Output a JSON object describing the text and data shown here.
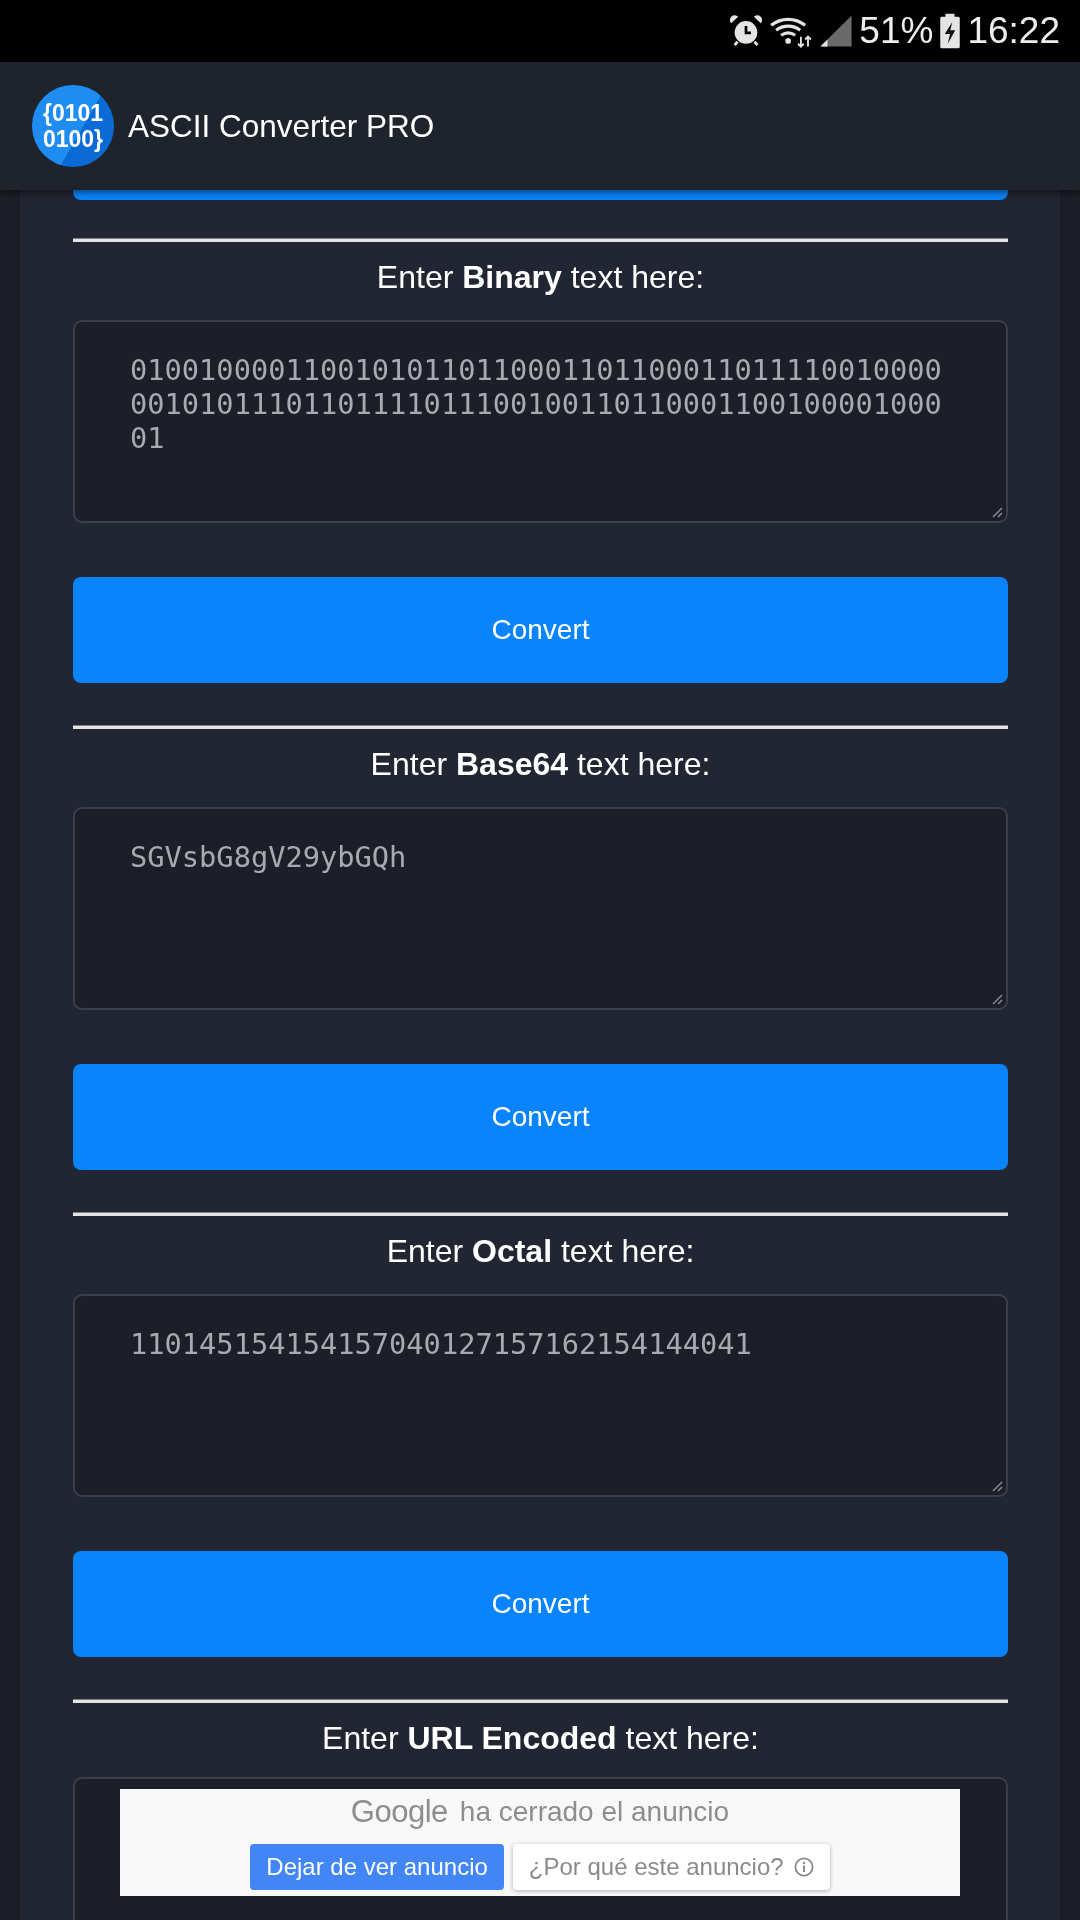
{
  "status_bar": {
    "battery": "51%",
    "time": "16:22"
  },
  "app_bar": {
    "logo": [
      "{0101",
      "0100}"
    ],
    "title": "ASCII Converter PRO"
  },
  "sections": [
    {
      "label": "Enter **Binary** text here:",
      "value": "010010000110010101101100011011000110111100100000010101110110111101110010011011000110010000100001",
      "button": "Convert"
    },
    {
      "label": "Enter **Base64** text here:",
      "value": "SGVsbG8gV29ybGQh",
      "button": "Convert"
    },
    {
      "label": "Enter **Octal** text here:",
      "value": "110145154154157040127157162154144041",
      "button": "Convert"
    },
    {
      "label": "Enter **URL Encoded** text here:"
    }
  ],
  "ad": {
    "brand": "Google",
    "message": "ha cerrado el anuncio",
    "buttons": [
      {
        "kind": "primary",
        "label": "Dejar de ver anuncio"
      },
      {
        "kind": "info",
        "label": "¿Por qué este anuncio?"
      }
    ]
  }
}
